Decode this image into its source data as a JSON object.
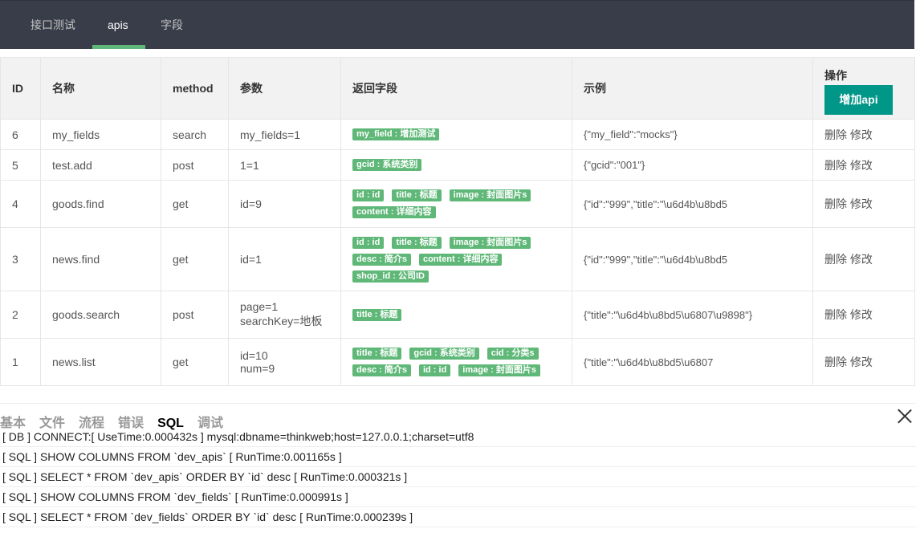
{
  "nav": {
    "items": [
      {
        "label": "接口测试"
      },
      {
        "label": "apis"
      },
      {
        "label": "字段"
      }
    ]
  },
  "table": {
    "headers": {
      "id": "ID",
      "name": "名称",
      "method": "method",
      "params": "参数",
      "fields": "返回字段",
      "example": "示例",
      "ops": "操作"
    },
    "add_button": "增加api",
    "delete_label": "删除",
    "edit_label": "修改",
    "rows": [
      {
        "id": "6",
        "name": "my_fields",
        "method": "search",
        "params": [
          "my_fields=1"
        ],
        "tags": [
          "my_field : 增加测试"
        ],
        "example": "{\"my_field\":\"mocks\"}"
      },
      {
        "id": "5",
        "name": "test.add",
        "method": "post",
        "params": [
          "1=1"
        ],
        "tags": [
          "gcid : 系统类别"
        ],
        "example": "{\"gcid\":\"001\"}"
      },
      {
        "id": "4",
        "name": "goods.find",
        "method": "get",
        "params": [
          "id=9"
        ],
        "tags": [
          "id : id",
          "title : 标题",
          "image : 封面图片s",
          "content : 详细内容"
        ],
        "example": "{\"id\":\"999\",\"title\":\"\\u6d4b\\u8bd5"
      },
      {
        "id": "3",
        "name": "news.find",
        "method": "get",
        "params": [
          "id=1"
        ],
        "tags": [
          "id : id",
          "title : 标题",
          "image : 封面图片s",
          "desc : 简介s",
          "content : 详细内容",
          "shop_id : 公司ID"
        ],
        "example": "{\"id\":\"999\",\"title\":\"\\u6d4b\\u8bd5"
      },
      {
        "id": "2",
        "name": "goods.search",
        "method": "post",
        "params": [
          "page=1",
          "searchKey=地板"
        ],
        "tags": [
          "title : 标题"
        ],
        "example": "{\"title\":\"\\u6d4b\\u8bd5\\u6807\\u9898\"}"
      },
      {
        "id": "1",
        "name": "news.list",
        "method": "get",
        "params": [
          "id=10",
          "num=9"
        ],
        "tags": [
          "title : 标题",
          "gcid : 系统类别",
          "cid : 分类s",
          "desc : 简介s",
          "id : id",
          "image : 封面图片s"
        ],
        "example": "{\"title\":\"\\u6d4b\\u8bd5\\u6807"
      }
    ]
  },
  "trace": {
    "tabs": [
      "基本",
      "文件",
      "流程",
      "错误",
      "SQL",
      "调试"
    ],
    "active_tab": "SQL",
    "lines": [
      "[ DB ] CONNECT:[ UseTime:0.000432s ] mysql:dbname=thinkweb;host=127.0.0.1;charset=utf8",
      "[ SQL ] SHOW COLUMNS FROM `dev_apis` [ RunTime:0.001165s ]",
      "[ SQL ] SELECT * FROM `dev_apis` ORDER BY `id` desc [ RunTime:0.000321s ]",
      "[ SQL ] SHOW COLUMNS FROM `dev_fields` [ RunTime:0.000991s ]",
      "[ SQL ] SELECT * FROM `dev_fields` ORDER BY `id` desc [ RunTime:0.000239s ]"
    ]
  },
  "colors": {
    "topbar": "#393d49",
    "accent": "#5fb878",
    "button": "#009688"
  }
}
